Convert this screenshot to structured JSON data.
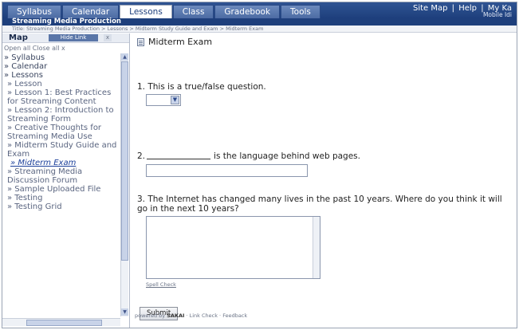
{
  "tabs": [
    {
      "label": "Syllabus",
      "active": false
    },
    {
      "label": "Calendar",
      "active": false
    },
    {
      "label": "Lessons",
      "active": true
    },
    {
      "label": "Class",
      "active": false
    },
    {
      "label": "Gradebook",
      "active": false
    },
    {
      "label": "Tools",
      "active": false
    }
  ],
  "top_links": {
    "site_map": "Site Map",
    "help": "Help",
    "my": "My Ka"
  },
  "user_line": "Mobile Idi",
  "course_title": "Streaming Media Production",
  "breadcrumb": "Title: Streaming Media Production > Lessons > Midterm Study Guide and Exam > Midterm Exam",
  "left_nav": {
    "title": "Map",
    "toggle_label": "Hide Link",
    "close_label": "x",
    "controls": "Open all   Close all   x",
    "items": [
      {
        "label": "» Syllabus",
        "level": 1
      },
      {
        "label": "» Calendar",
        "level": 1
      },
      {
        "label": "» Lessons",
        "level": 1
      },
      {
        "label": "» Lesson",
        "level": 2
      },
      {
        "label": "» Lesson 1: Best Practices for Streaming Content",
        "level": 2
      },
      {
        "label": "» Lesson 2: Introduction to Streaming Form",
        "level": 2
      },
      {
        "label": "» Creative Thoughts for Streaming Media Use",
        "level": 2
      },
      {
        "label": "» Midterm Study Guide and Exam",
        "level": 2
      },
      {
        "label": "» Midterm Exam",
        "level": 3,
        "current": true
      },
      {
        "label": "» Streaming Media Discussion Forum",
        "level": 2
      },
      {
        "label": "» Sample Uploaded File",
        "level": 2
      },
      {
        "label": "» Testing",
        "level": 2
      },
      {
        "label": "» Testing Grid",
        "level": 2
      }
    ]
  },
  "exam": {
    "title": "Midterm Exam",
    "q1": "1. This is a true/false question.",
    "q2_prefix": "2.",
    "q2_suffix": "is the language behind web pages.",
    "q3": "3. The Internet has changed many lives in the past 10 years. Where do you think it will go in the next 10 years?",
    "spell_check": "Spell Check",
    "submit_label": "Submit"
  },
  "footer": {
    "powered_by": "powered by",
    "brand": "SAKAI",
    "rest": "  ·  Link Check  ·  Feedback"
  }
}
